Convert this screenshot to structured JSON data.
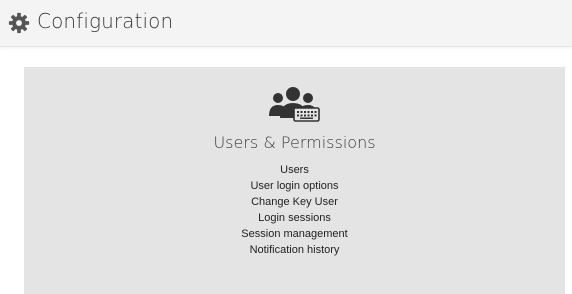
{
  "header": {
    "title": "Configuration",
    "icon": "gear-icon"
  },
  "panel": {
    "icon": "users-keyboard-icon",
    "title": "Users & Permissions",
    "links": [
      "Users",
      "User login options",
      "Change Key User",
      "Login sessions",
      "Session management",
      "Notification history"
    ]
  }
}
